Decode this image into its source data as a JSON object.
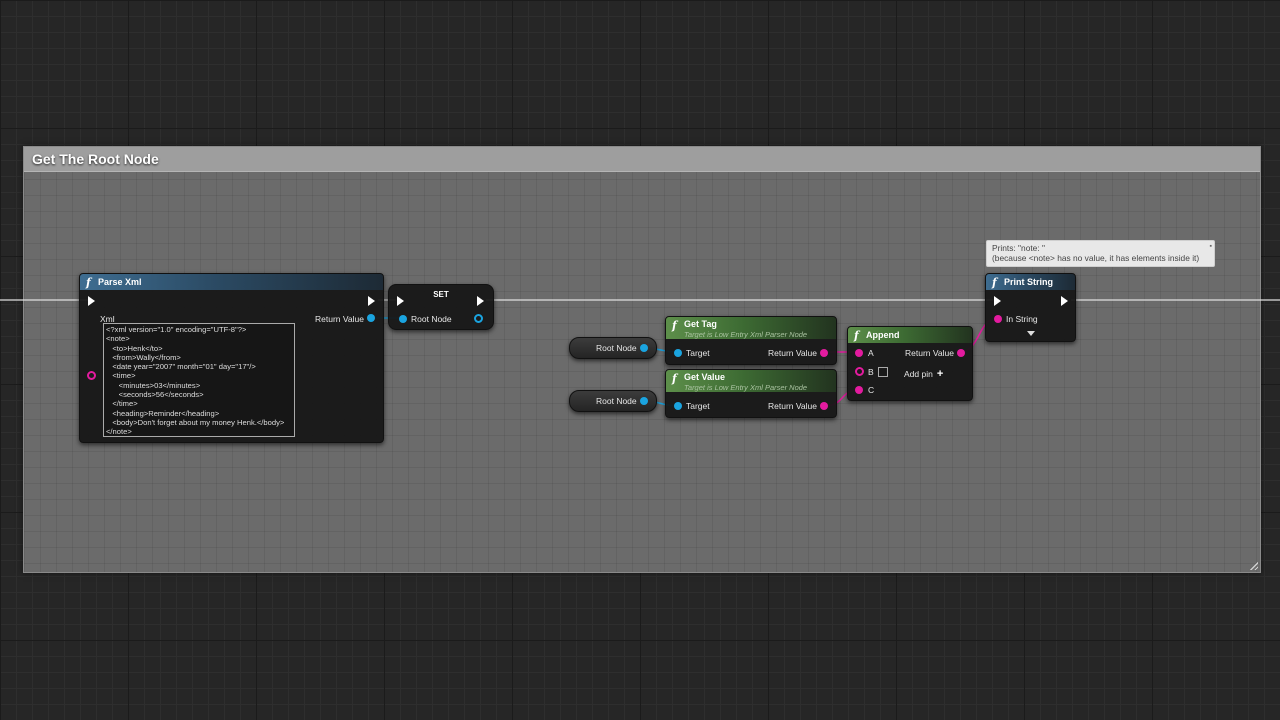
{
  "comment": {
    "title": "Get The Root Node"
  },
  "parse_xml": {
    "title": "Parse Xml",
    "xml_label": "Xml",
    "return_label": "Return Value",
    "xml_value": "<?xml version=\"1.0\" encoding=\"UTF-8\"?>\n<note>\n   <to>Henk</to>\n   <from>Wally</from>\n   <date year=\"2007\" month=\"01\" day=\"17\"/>\n   <time>\n      <minutes>03</minutes>\n      <seconds>56</seconds>\n   </time>\n   <heading>Reminder</heading>\n   <body>Don't forget about my money Henk.</body>\n</note>"
  },
  "set_node": {
    "title": "SET",
    "pin_label": "Root Node"
  },
  "var_nodes": [
    {
      "label": "Root Node"
    },
    {
      "label": "Root Node"
    }
  ],
  "get_tag": {
    "title": "Get Tag",
    "subtitle": "Target is Low Entry Xml Parser Node",
    "target_label": "Target",
    "return_label": "Return Value"
  },
  "get_value": {
    "title": "Get Value",
    "subtitle": "Target is Low Entry Xml Parser Node",
    "target_label": "Target",
    "return_label": "Return Value"
  },
  "append": {
    "title": "Append",
    "pin_a": "A",
    "pin_b": "B",
    "pin_c": "C",
    "return_label": "Return Value",
    "add_pin_label": "Add pin",
    "add_pin_icon": "+"
  },
  "print_string": {
    "title": "Print String",
    "in_string_label": "In String"
  },
  "tooltip": {
    "line1": "Prints: \"note: \"",
    "line2": "(because <note> has no value, it has elements inside it)"
  },
  "icons": {
    "function": "f",
    "exec_pin": "exec-arrow",
    "data_pin": "circle"
  },
  "colors": {
    "string_pin": "#e31b9f",
    "object_pin": "#1aa4e0",
    "exec_wire": "#ffffff",
    "function_header": "#3e6d91",
    "pure_header": "#5d8f4a"
  }
}
